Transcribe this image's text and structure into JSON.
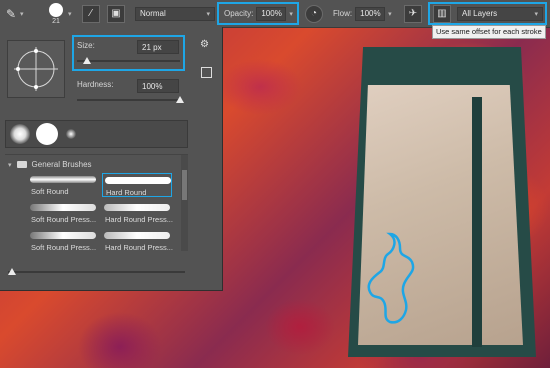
{
  "options_bar": {
    "brush_size": "21",
    "mode_value": "Normal",
    "opacity_label": "Opacity:",
    "opacity_value": "100%",
    "flow_label": "Flow:",
    "flow_value": "100%",
    "sample_value": "All Layers"
  },
  "tooltip": "Use same offset for each stroke",
  "brush_panel": {
    "size_label": "Size:",
    "size_value": "21 px",
    "size_level": 0.1,
    "hardness_label": "Hardness:",
    "hardness_value": "100%",
    "hardness_level": 1.0,
    "group_name": "General Brushes",
    "brushes": [
      {
        "name": "Soft Round",
        "selected": false
      },
      {
        "name": "Hard Round",
        "selected": true
      },
      {
        "name": "Soft Round Press...",
        "selected": false
      },
      {
        "name": "Hard Round Press...",
        "selected": false
      },
      {
        "name": "Soft Round Press...",
        "selected": false
      },
      {
        "name": "Hard Round Press...",
        "selected": false
      }
    ]
  },
  "colors": {
    "highlight": "#1ea6e6",
    "panel_bg": "#535353"
  },
  "icons": [
    "brush-tool-icon",
    "airbrush-icon",
    "pressure-opacity-icon",
    "pressure-size-icon",
    "gear-icon",
    "clone-source-icon"
  ]
}
